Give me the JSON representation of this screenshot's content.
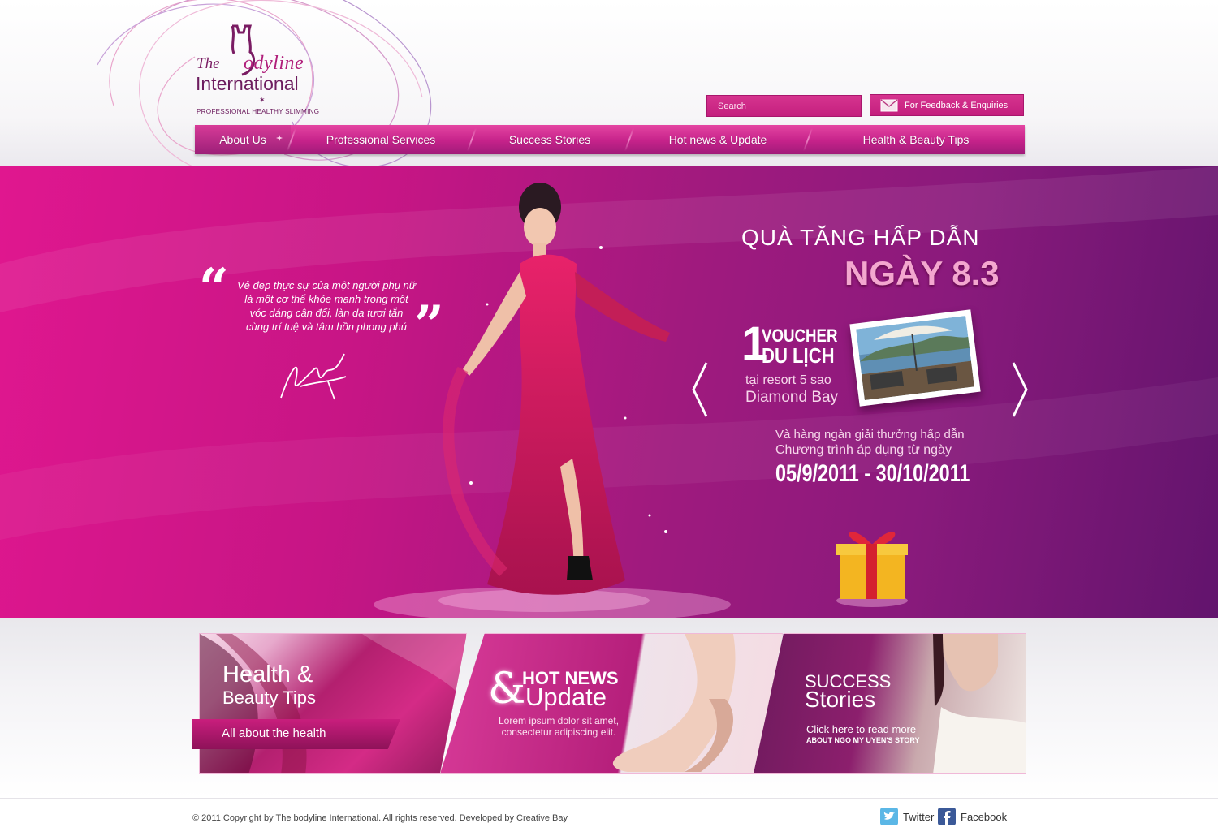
{
  "brand": {
    "logo_the": "The",
    "logo_bodyline": "odyline",
    "logo_international": "International",
    "logo_tagline": "PROFESSIONAL HEALTHY SLIMMING",
    "accent_color": "#c41f7e",
    "dark_color": "#6d1d5f"
  },
  "header": {
    "search_placeholder": "Search",
    "feedback_label": "For Feedback & Enquiries",
    "nav": [
      {
        "label": "About Us"
      },
      {
        "label": "Professional Services"
      },
      {
        "label": "Success Stories"
      },
      {
        "label": "Hot news & Update"
      },
      {
        "label": "Health & Beauty Tips"
      }
    ]
  },
  "banner": {
    "quote_lines": [
      "Vẻ đẹp thực sự của một người phụ nữ",
      "là một cơ thể khỏe mạnh trong một",
      "vóc dáng cân đối, làn da tươi tắn",
      "cùng trí tuệ và tâm hồn phong phú"
    ],
    "promo_title": "QUÀ TĂNG HẤP DẪN",
    "promo_day": "NGÀY 8.3",
    "voucher_number": "1",
    "voucher_line1": "VOUCHER",
    "voucher_line2": "DU LỊCH",
    "voucher_resort": "tại resort 5 sao",
    "voucher_place": "Diamond Bay",
    "promo_sub1": "Và hàng ngàn giải thưởng hấp dẫn",
    "promo_sub2": "Chương trình áp dụng từ ngày",
    "promo_range": "05/9/2011 - 30/10/2011"
  },
  "tiles": {
    "health": {
      "title1": "Health &",
      "title2": "Beauty Tips",
      "ribbon": "All about the health"
    },
    "news": {
      "amp": "&",
      "hot": "HOT NEWS",
      "update": "Update",
      "lorem": "Lorem ipsum dolor sit amet, consectetur adipiscing elit."
    },
    "stories": {
      "success": "SUCCESS",
      "stories": "Stories",
      "click": "Click here to read more",
      "about": "ABOUT NGO MY UYEN'S STORY"
    }
  },
  "footer": {
    "copyright": "© 2011 Copyright by The bodyline International. All rights reserved. Developed by Creative Bay",
    "twitter": "Twitter",
    "facebook": "Facebook"
  }
}
